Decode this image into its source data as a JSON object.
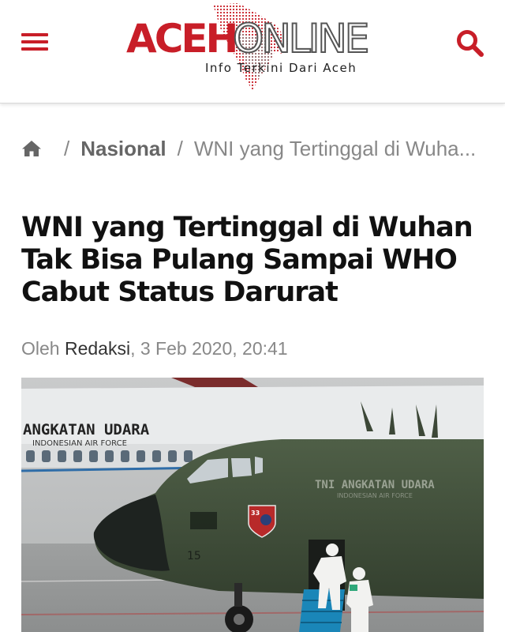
{
  "header": {
    "menu_icon": "hamburger-menu-icon",
    "logo": {
      "part1": "ACEH",
      "part2": "ONLINE",
      "tagline": "Info Terkini Dari Aceh"
    },
    "search_icon": "search-icon",
    "accent_color": "#c81e28"
  },
  "breadcrumb": {
    "home_icon": "home-icon",
    "separator": "/",
    "category": "Nasional",
    "current": "WNI yang Tertinggal di Wuha..."
  },
  "article": {
    "title": "WNI yang Tertinggal di Wuhan Tak Bisa Pulang Sampai WHO Cabut Status Darurat",
    "byline_prefix": "Oleh",
    "author": "Redaksi",
    "date": ", 3 Feb 2020, 20:41"
  },
  "photo": {
    "plane_white_text": "ANGKATAN UDARA",
    "plane_white_subtext": "INDONESIAN AIR FORCE",
    "plane_green_text": "TNI ANGKATAN UDARA",
    "plane_green_subtext": "INDONESIAN AIR FORCE",
    "badge_number": "33",
    "tail_number": "15"
  }
}
